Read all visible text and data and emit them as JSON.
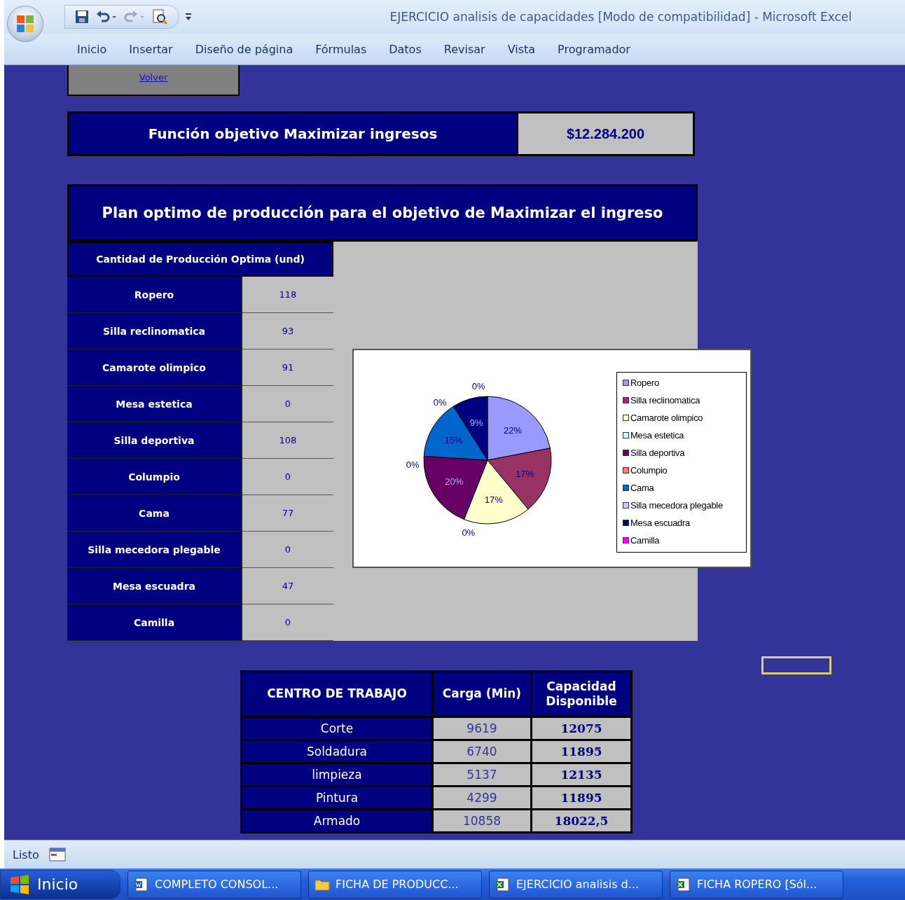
{
  "window": {
    "title": "EJERCICIO analisis de capacidades  [Modo de compatibilidad] - Microsoft Excel"
  },
  "ribbon_tabs": [
    "Inicio",
    "Insertar",
    "Diseño de página",
    "Fórmulas",
    "Datos",
    "Revisar",
    "Vista",
    "Programador"
  ],
  "sheet": {
    "back_link": "Volver",
    "objective": {
      "label": "Función objetivo Maximizar ingresos",
      "value": "$12.284.200"
    },
    "plan": {
      "title": "Plan optimo de producción para el objetivo de Maximizar el ingreso",
      "column_header": "Cantidad de Producción Optima (und)",
      "products": [
        {
          "name": "Ropero",
          "quantity": "118"
        },
        {
          "name": "Silla reclinomatica",
          "quantity": "93"
        },
        {
          "name": "Camarote olimpico",
          "quantity": "91"
        },
        {
          "name": "Mesa estetica",
          "quantity": "0"
        },
        {
          "name": "Silla deportiva",
          "quantity": "108"
        },
        {
          "name": "Columpio",
          "quantity": "0"
        },
        {
          "name": "Cama",
          "quantity": "77"
        },
        {
          "name": "Silla mecedora plegable",
          "quantity": "0"
        },
        {
          "name": "Mesa escuadra",
          "quantity": "47"
        },
        {
          "name": "Camilla",
          "quantity": "0"
        }
      ],
      "chart_data": {
        "type": "pie",
        "categories": [
          "Ropero",
          "Silla reclinomatica",
          "Camarote olimpico",
          "Mesa estetica",
          "Silla deportiva",
          "Columpio",
          "Cama",
          "Silla mecedora plegable",
          "Mesa escuadra",
          "Camilla"
        ],
        "values": [
          22,
          17,
          17,
          0,
          20,
          0,
          15,
          0,
          9,
          0
        ],
        "legend": true,
        "value_labels": [
          "22%",
          "17%",
          "17%",
          "0%",
          "20%",
          "0%",
          "15%",
          "0%",
          "9%",
          "0%"
        ]
      }
    },
    "work_centers": {
      "columns": [
        "CENTRO DE TRABAJO",
        "Carga (Min)",
        "Capacidad Disponible"
      ],
      "rows": [
        {
          "name": "Corte",
          "load": "9619",
          "capacity": "12075"
        },
        {
          "name": "Soldadura",
          "load": "6740",
          "capacity": "11895"
        },
        {
          "name": "limpieza",
          "load": "5137",
          "capacity": "12135"
        },
        {
          "name": "Pintura",
          "load": "4299",
          "capacity": "11895"
        },
        {
          "name": "Armado",
          "load": "10858",
          "capacity": "18022,5"
        }
      ]
    }
  },
  "status_bar": {
    "status": "Listo"
  },
  "taskbar": {
    "start": "Inicio",
    "tasks": [
      {
        "kind": "word",
        "label": "COMPLETO CONSOL..."
      },
      {
        "kind": "folder",
        "label": "FICHA DE PRODUCC..."
      },
      {
        "kind": "excel",
        "label": "EJERCICIO analisis d..."
      },
      {
        "kind": "excel",
        "label": "FICHA ROPERO  [Sól..."
      }
    ]
  }
}
